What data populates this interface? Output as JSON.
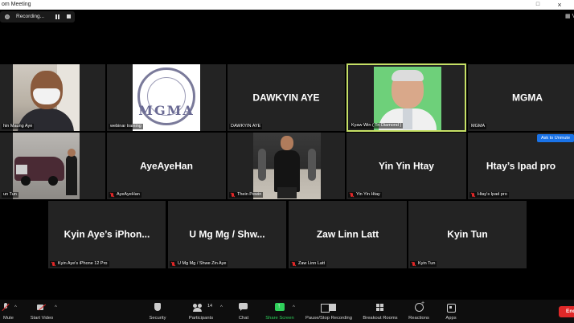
{
  "window": {
    "title": "om Meeting",
    "restore_glyph": "□",
    "view_label": "V"
  },
  "recording": {
    "label": "Recording..."
  },
  "tiles": [
    {
      "id": "chin-maung-aye",
      "display": "",
      "name": "hin Maung Aye"
    },
    {
      "id": "webinar",
      "display": "",
      "name": "webinar training",
      "logo_text": "MGMA"
    },
    {
      "id": "dawkyin",
      "display": "DAWKYIN AYE",
      "name": "DAWKYIN AYE"
    },
    {
      "id": "kyaw-win",
      "display": "",
      "name": "Kyaw Win ( Tri Diamond )"
    },
    {
      "id": "mgma",
      "display": "MGMA",
      "name": "MGMA"
    },
    {
      "id": "un-tun",
      "display": "",
      "name": "un Tun"
    },
    {
      "id": "ayeayehan",
      "display": "AyeAyeHan",
      "name": "AyeAyeHan"
    },
    {
      "id": "thein-pewin",
      "display": "",
      "name": "Thein Pewin"
    },
    {
      "id": "yin-yin-htay",
      "display": "Yin Yin Htay",
      "name": "Yin Yin Htay"
    },
    {
      "id": "htay-ipad",
      "display": "Htay’s Ipad pro",
      "name": "Htay's Ipad pro"
    },
    {
      "id": "kyin-aye-iphone",
      "display": "Kyin Aye’s iPhon...",
      "name": "Kyin Aye's iPhone 12 Pro"
    },
    {
      "id": "u-mg-mg",
      "display": "U Mg Mg / Shw...",
      "name": "U Mg Mg / Shwe Zin Aye"
    },
    {
      "id": "zaw-linn-latt",
      "display": "Zaw Linn Latt",
      "name": "Zaw Linn Latt"
    },
    {
      "id": "kyin-tun",
      "display": "Kyin Tun",
      "name": "Kyin Tun"
    }
  ],
  "ask_to_unmute": "Ask to Unmute",
  "toolbar": {
    "mute": "Mute",
    "start_video": "Start Video",
    "security": "Security",
    "participants": "Participants",
    "participants_count": "14",
    "chat": "Chat",
    "share_screen": "Share Screen",
    "pause_stop_recording": "Pause/Stop Recording",
    "breakout_rooms": "Breakout Rooms",
    "reactions": "Reactions",
    "apps": "Apps",
    "end": "End",
    "caret": "^"
  },
  "colors": {
    "speaking_border": "#c6e066",
    "share_green": "#2fd05a",
    "end_red": "#e02828",
    "unmute_blue": "#1a73e8"
  }
}
